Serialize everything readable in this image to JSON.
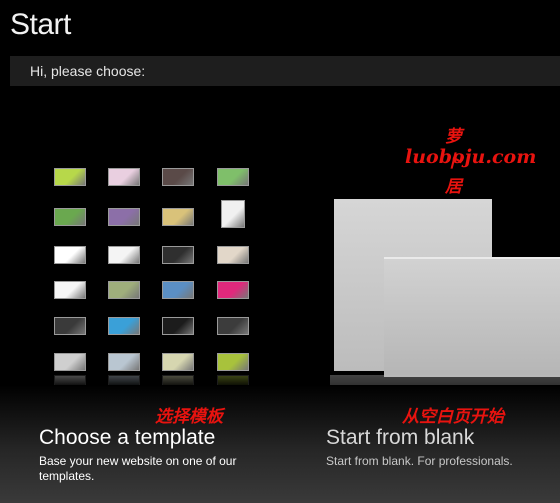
{
  "page_title": "Start",
  "greeting": "Hi, please choose:",
  "watermark": {
    "line1": "萝卜居",
    "line2": "luoboju.com"
  },
  "template_option": {
    "annotation": "选择模板",
    "title": "Choose a template",
    "description": "Base your new website on one of our templates."
  },
  "blank_option": {
    "annotation": "从空白页开始",
    "title": "Start from blank",
    "description": "Start from blank. For professionals."
  },
  "thumbnail_colors": [
    [
      "#b7d84a",
      "#e9cfe0",
      "#5a4a48",
      "#7fbf6a"
    ],
    [
      "#6aa84f",
      "#8c6fa8",
      "#d9c27a",
      "#f0f0f0"
    ],
    [
      "#ffffff",
      "#f4f4f4",
      "#2f2f2f",
      "#e2d7c9"
    ],
    [
      "#f6f6f6",
      "#9fae7c",
      "#5b8fc4",
      "#e0297c"
    ],
    [
      "#3a3a3a",
      "#3aa0d8",
      "#1c1c1c",
      "#3c3c3c"
    ],
    [
      "#cfcfcf",
      "#b9c6d1",
      "#d6d6b0",
      "#a8c23c"
    ]
  ]
}
